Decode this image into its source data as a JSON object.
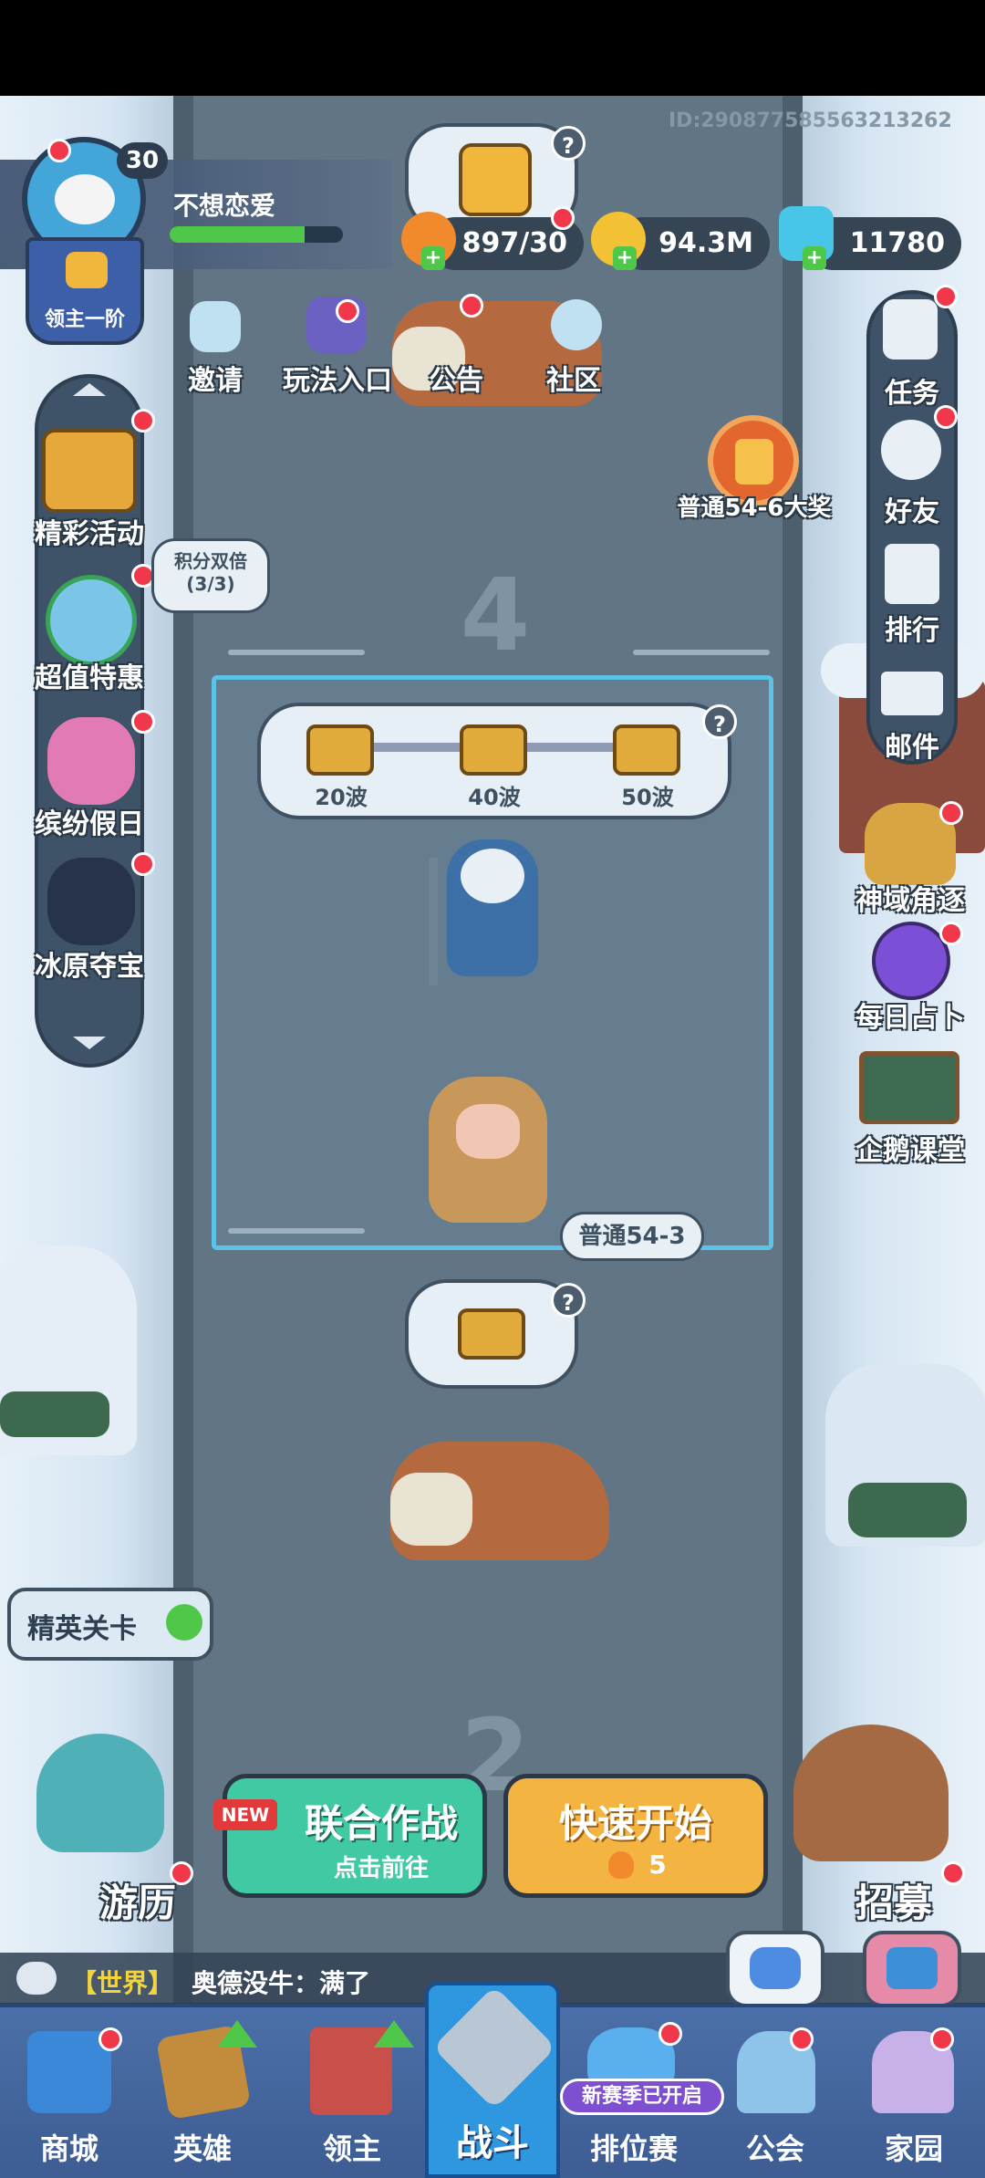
{
  "player": {
    "id_text": "ID:290877585563213262",
    "level": "30",
    "name": "不想恋爱",
    "rank_badge": "领主一阶",
    "xp_fraction": 0.78
  },
  "resources": {
    "stamina": "897/30",
    "gold": "94.3M",
    "gems": "11780"
  },
  "top_shortcuts": [
    {
      "label": "邀请",
      "icon": "penguin-icon"
    },
    {
      "label": "玩法入口",
      "icon": "gamepad-icon"
    },
    {
      "label": "公告",
      "icon": "megaphone-icon"
    },
    {
      "label": "社区",
      "icon": "community-icon"
    }
  ],
  "left_menu": [
    {
      "label": "精彩活动",
      "icon": "chest-icon"
    },
    {
      "label": "超值特惠",
      "icon": "clock-icon"
    },
    {
      "label": "缤纷假日",
      "icon": "holiday-girl-icon"
    },
    {
      "label": "冰原夺宝",
      "icon": "anubis-icon"
    }
  ],
  "points_double": {
    "title": "积分双倍",
    "count": "(3/3)"
  },
  "right_menu": [
    {
      "label": "任务",
      "icon": "clipboard-icon"
    },
    {
      "label": "好友",
      "icon": "friends-icon"
    },
    {
      "label": "排行",
      "icon": "leaderboard-icon"
    },
    {
      "label": "邮件",
      "icon": "mail-icon"
    }
  ],
  "right_events": [
    {
      "label": "神域角逐",
      "icon": "wings-emblem-icon"
    },
    {
      "label": "每日占卜",
      "icon": "crystal-ball-icon"
    },
    {
      "label": "企鹅课堂",
      "icon": "chalkboard-icon"
    }
  ],
  "big_reward": {
    "label": "普通54-6大奖"
  },
  "stage": {
    "next_stage_digit": "4",
    "lower_stage_digit": "2",
    "current_label": "普通54-3",
    "wave_rewards": [
      {
        "label": "20波"
      },
      {
        "label": "40波"
      },
      {
        "label": "50波"
      }
    ]
  },
  "elite": {
    "label": "精英关卡"
  },
  "travel": {
    "label": "游历"
  },
  "recruit": {
    "label": "招募"
  },
  "coop": {
    "new_badge": "NEW",
    "title": "联合作战",
    "subtitle": "点击前往"
  },
  "quick_start": {
    "title": "快速开始",
    "cost": "5"
  },
  "chat": {
    "channel": "【世界】",
    "message": "奥德没牛：满了"
  },
  "bottom_nav": [
    {
      "label": "商城",
      "icon": "shop-icon"
    },
    {
      "label": "英雄",
      "icon": "hero-card-icon"
    },
    {
      "label": "领主",
      "icon": "banner-icon"
    },
    {
      "label": "战斗",
      "icon": "crossed-weapons-icon"
    },
    {
      "label": "排位赛",
      "icon": "ranked-emblem-icon"
    },
    {
      "label": "公会",
      "icon": "guild-castle-icon"
    },
    {
      "label": "家园",
      "icon": "home-castle-icon"
    }
  ],
  "season_badge": "新赛季已开启",
  "colors": {
    "road": "#617585",
    "snow": "#dce8f3",
    "coop_green": "#41c9a4",
    "quick_orange": "#f3b441",
    "nav_bg": "#4b6fa8",
    "alert_red": "#f0384a"
  }
}
